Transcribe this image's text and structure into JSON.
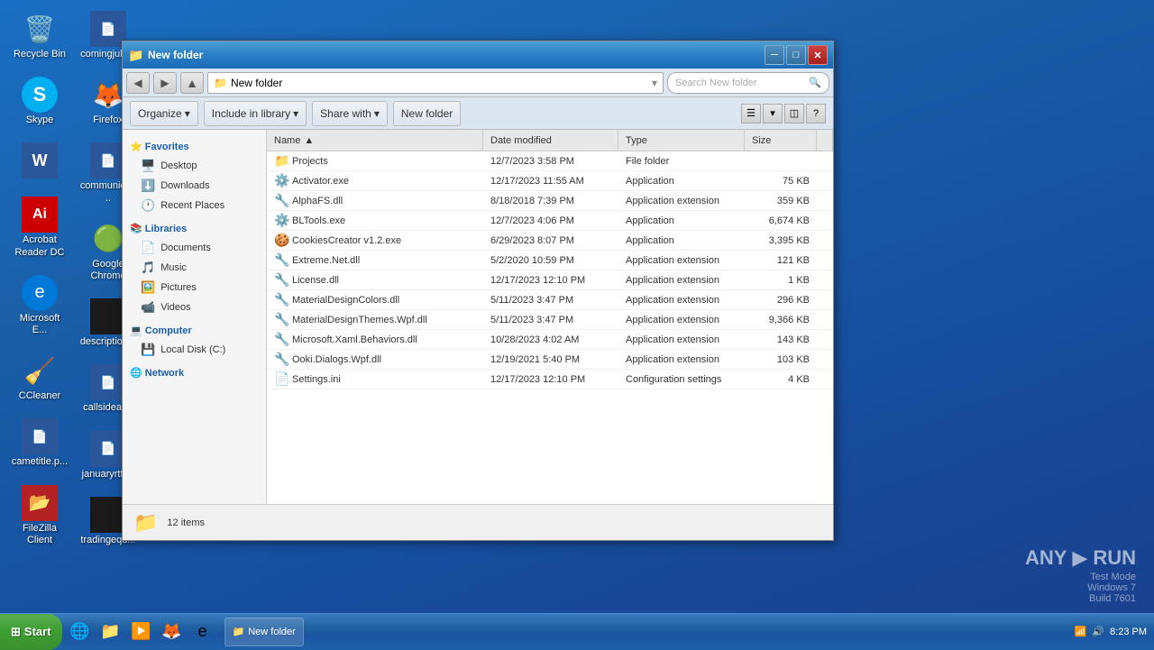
{
  "desktop": {
    "background": "#1a5fa8",
    "icons": [
      {
        "id": "recycle-bin",
        "label": "Recycle Bin",
        "icon": "🗑️"
      },
      {
        "id": "skype",
        "label": "Skype",
        "icon": "🟦"
      },
      {
        "id": "word",
        "label": "",
        "icon": "📄"
      },
      {
        "id": "acrobat",
        "label": "Acrobat Reader DC",
        "icon": "🔴"
      },
      {
        "id": "microsoft-edge",
        "label": "Microsoft E...",
        "icon": "🌐"
      },
      {
        "id": "ccleaner",
        "label": "CCleaner",
        "icon": "🧹"
      },
      {
        "id": "cametitle",
        "label": "cametitle.p...",
        "icon": "📄"
      },
      {
        "id": "filezilla",
        "label": "FileZilla Client",
        "icon": "🟧"
      },
      {
        "id": "comingjul",
        "label": "comingjul.r...",
        "icon": "📄"
      },
      {
        "id": "firefox",
        "label": "Firefox",
        "icon": "🦊"
      },
      {
        "id": "communicat",
        "label": "communicat...",
        "icon": "📄"
      },
      {
        "id": "chrome",
        "label": "Google Chrome",
        "icon": "🟢"
      },
      {
        "id": "description",
        "label": "description...",
        "icon": "⬛"
      },
      {
        "id": "callsidea",
        "label": "callsidea.rtf",
        "icon": "📄"
      },
      {
        "id": "januaryrtf",
        "label": "januaryrtf.rtf",
        "icon": "📄"
      },
      {
        "id": "tradingequ",
        "label": "tradingequ...",
        "icon": "⬛"
      }
    ]
  },
  "window": {
    "title": "New folder",
    "address": "New folder",
    "search_placeholder": "Search New folder",
    "toolbar": {
      "organize": "Organize",
      "include_library": "Include in library",
      "share_with": "Share with",
      "new_folder": "New folder"
    },
    "columns": {
      "name": "Name",
      "date_modified": "Date modified",
      "type": "Type",
      "size": "Size"
    },
    "files": [
      {
        "name": "Projects",
        "date": "12/7/2023 3:58 PM",
        "type": "File folder",
        "size": "",
        "icon": "📁"
      },
      {
        "name": "Activator.exe",
        "date": "12/17/2023 11:55 AM",
        "type": "Application",
        "size": "75 KB",
        "icon": "⚙️"
      },
      {
        "name": "AlphaFS.dll",
        "date": "8/18/2018 7:39 PM",
        "type": "Application extension",
        "size": "359 KB",
        "icon": "🔧"
      },
      {
        "name": "BLTools.exe",
        "date": "12/7/2023 4:06 PM",
        "type": "Application",
        "size": "6,674 KB",
        "icon": "⚙️"
      },
      {
        "name": "CookiesCreator v1.2.exe",
        "date": "6/29/2023 8:07 PM",
        "type": "Application",
        "size": "3,395 KB",
        "icon": "🍪"
      },
      {
        "name": "Extreme.Net.dll",
        "date": "5/2/2020 10:59 PM",
        "type": "Application extension",
        "size": "121 KB",
        "icon": "🔧"
      },
      {
        "name": "License.dll",
        "date": "12/17/2023 12:10 PM",
        "type": "Application extension",
        "size": "1 KB",
        "icon": "🔧"
      },
      {
        "name": "MaterialDesignColors.dll",
        "date": "5/11/2023 3:47 PM",
        "type": "Application extension",
        "size": "296 KB",
        "icon": "🔧"
      },
      {
        "name": "MaterialDesignThemes.Wpf.dll",
        "date": "5/11/2023 3:47 PM",
        "type": "Application extension",
        "size": "9,366 KB",
        "icon": "🔧"
      },
      {
        "name": "Microsoft.Xaml.Behaviors.dll",
        "date": "10/28/2023 4:02 AM",
        "type": "Application extension",
        "size": "143 KB",
        "icon": "🔧"
      },
      {
        "name": "Ooki.Dialogs.Wpf.dll",
        "date": "12/19/2021 5:40 PM",
        "type": "Application extension",
        "size": "103 KB",
        "icon": "🔧"
      },
      {
        "name": "Settings.ini",
        "date": "12/17/2023 12:10 PM",
        "type": "Configuration settings",
        "size": "4 KB",
        "icon": "📄"
      }
    ],
    "status": "12 items",
    "nav": {
      "favorites": "Favorites",
      "favorites_items": [
        "Desktop",
        "Downloads",
        "Recent Places"
      ],
      "libraries": "Libraries",
      "libraries_items": [
        "Documents",
        "Music",
        "Pictures",
        "Videos"
      ],
      "computer": "Computer",
      "computer_items": [
        "Local Disk (C:)"
      ],
      "network": "Network"
    }
  },
  "taskbar": {
    "start_label": "Start",
    "time": "8:23 PM",
    "date": "",
    "build_info": "Test Mode\nWindows 7\nBuild 7601",
    "anyrun_label": "ANY▶RUN"
  }
}
